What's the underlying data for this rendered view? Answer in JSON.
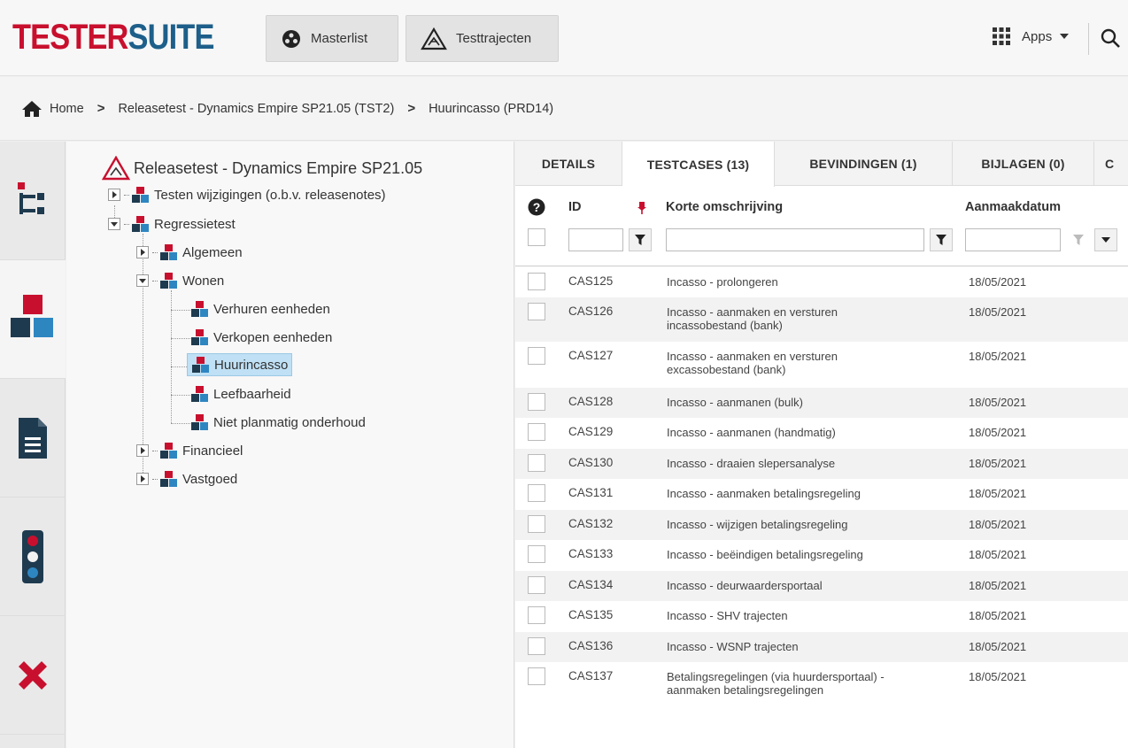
{
  "header": {
    "logo_part1": "TESTER",
    "logo_part2": "SUITE",
    "nav": [
      {
        "label": "Masterlist",
        "icon": "masterlist-icon"
      },
      {
        "label": "Testtrajecten",
        "icon": "testtraject-icon"
      }
    ],
    "apps_label": "Apps"
  },
  "breadcrumb": {
    "home": "Home",
    "level1": "Releasetest - Dynamics Empire SP21.05 (TST2)",
    "level2": "Huurincasso (PRD14)"
  },
  "rail": [
    {
      "icon": "tree-structure-icon"
    },
    {
      "icon": "blocks-icon"
    },
    {
      "icon": "document-icon"
    },
    {
      "icon": "traffic-light-icon"
    },
    {
      "icon": "close-x-icon"
    }
  ],
  "tree": {
    "root": "Releasetest - Dynamics Empire SP21.05",
    "nodes": [
      {
        "label": "Testen wijzigingen (o.b.v. releasenotes)"
      },
      {
        "label": "Regressietest"
      },
      {
        "label": "Algemeen"
      },
      {
        "label": "Wonen"
      },
      {
        "label": "Verhuren eenheden"
      },
      {
        "label": "Verkopen eenheden"
      },
      {
        "label": "Huurincasso"
      },
      {
        "label": "Leefbaarheid"
      },
      {
        "label": "Niet planmatig onderhoud"
      },
      {
        "label": "Financieel"
      },
      {
        "label": "Vastgoed"
      }
    ]
  },
  "tabs": [
    {
      "label": "DETAILS"
    },
    {
      "label": "TESTCASES (13)"
    },
    {
      "label": "BEVINDINGEN (1)"
    },
    {
      "label": "BIJLAGEN (0)"
    },
    {
      "label": "C"
    }
  ],
  "table": {
    "columns": {
      "id": "ID",
      "description": "Korte omschrijving",
      "date": "Aanmaakdatum"
    },
    "rows": [
      {
        "id": "CAS125",
        "desc": "Incasso - prolongeren",
        "date": "18/05/2021"
      },
      {
        "id": "CAS126",
        "desc": "Incasso - aanmaken en versturen incassobestand (bank)",
        "date": "18/05/2021"
      },
      {
        "id": "CAS127",
        "desc": "Incasso - aanmaken en versturen excassobestand (bank)",
        "date": "18/05/2021"
      },
      {
        "id": "CAS128",
        "desc": "Incasso - aanmanen (bulk)",
        "date": "18/05/2021"
      },
      {
        "id": "CAS129",
        "desc": "Incasso - aanmanen (handmatig)",
        "date": "18/05/2021"
      },
      {
        "id": "CAS130",
        "desc": "Incasso - draaien slepersanalyse",
        "date": "18/05/2021"
      },
      {
        "id": "CAS131",
        "desc": "Incasso - aanmaken betalingsregeling",
        "date": "18/05/2021"
      },
      {
        "id": "CAS132",
        "desc": "Incasso - wijzigen betalingsregeling",
        "date": "18/05/2021"
      },
      {
        "id": "CAS133",
        "desc": "Incasso - beëindigen betalingsregeling",
        "date": "18/05/2021"
      },
      {
        "id": "CAS134",
        "desc": "Incasso - deurwaardersportaal",
        "date": "18/05/2021"
      },
      {
        "id": "CAS135",
        "desc": "Incasso - SHV trajecten",
        "date": "18/05/2021"
      },
      {
        "id": "CAS136",
        "desc": "Incasso - WSNP trajecten",
        "date": "18/05/2021"
      },
      {
        "id": "CAS137",
        "desc": "Betalingsregelingen (via huurdersportaal) - aanmaken betalingsregelingen",
        "date": "18/05/2021"
      }
    ]
  },
  "colors": {
    "brand_red": "#c8102e",
    "brand_blue": "#1d5f8a",
    "selected_bg": "#bfe0f5"
  }
}
